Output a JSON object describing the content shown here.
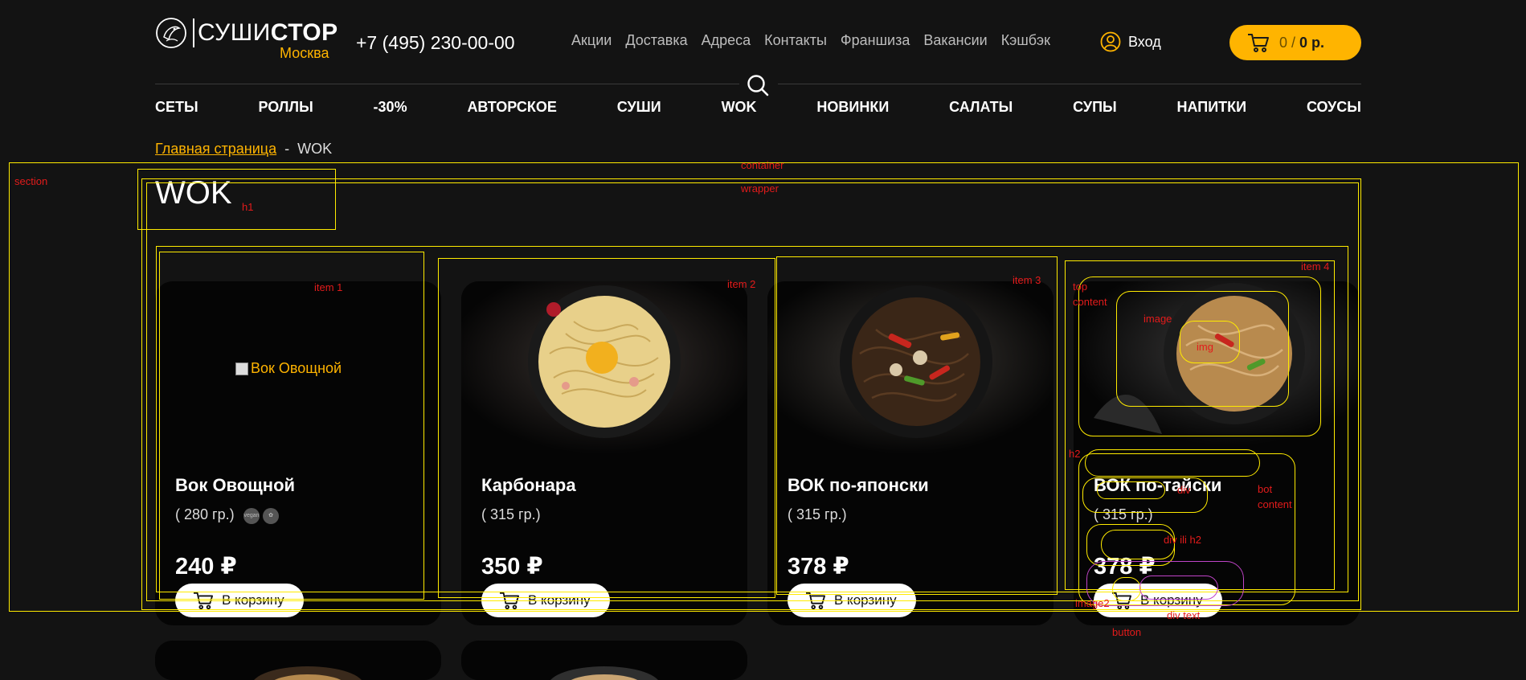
{
  "header": {
    "logo": {
      "text_light": "СУШИ",
      "text_bold": "СТОР",
      "city": "Москва"
    },
    "phone": "+7 (495) 230-00-00",
    "top_nav": [
      "Акции",
      "Доставка",
      "Адреса",
      "Контакты",
      "Франшиза",
      "Вакансии",
      "Кэшбэк"
    ],
    "login_label": "Вход",
    "cart": {
      "count": "0",
      "separator": " / ",
      "total": "0 р."
    }
  },
  "category_nav": [
    "СЕТЫ",
    "РОЛЛЫ",
    "-30%",
    "АВТОРСКОЕ",
    "СУШИ",
    "WOK",
    "НОВИНКИ",
    "САЛАТЫ",
    "СУПЫ",
    "НАПИТКИ",
    "СОУСЫ"
  ],
  "breadcrumb": {
    "home": "Главная страница",
    "separator": "-",
    "current": "WOK"
  },
  "page_title": "WOK",
  "products": [
    {
      "name": "Вок Овощной",
      "weight": "( 280 гр.)",
      "price": "240 ₽",
      "image_alt": "Вок Овощной",
      "image_broken": true,
      "badges": [
        "vegan",
        "veg"
      ]
    },
    {
      "name": "Карбонара",
      "weight": "( 315 гр.)",
      "price": "350 ₽",
      "image_alt": "Карбонара",
      "image_broken": false
    },
    {
      "name": "ВОК по-японски",
      "weight": "( 315 гр.)",
      "price": "378 ₽",
      "image_alt": "ВОК по-японски",
      "image_broken": false
    },
    {
      "name": "ВОК по-тайски",
      "weight": "( 315 гр.)",
      "price": "378 ₽",
      "image_alt": "ВОК по-тайски",
      "image_broken": false
    }
  ],
  "add_to_cart_label": "В корзину",
  "annotations": {
    "section": "section",
    "container": "container",
    "wrapper": "wrapper",
    "h1": "h1",
    "item1": "item 1",
    "item2": "item 2",
    "item3": "item 3",
    "item4": "item 4",
    "top_content": "top\ncontent",
    "image": "image",
    "img": "img",
    "h2": "h2",
    "div": "div",
    "bot_content": "bot\ncontent",
    "div_ili_h2": "div ili h2",
    "image2": "image2",
    "div_text": "div text",
    "button": "button"
  },
  "colors": {
    "background": "#131313",
    "card": "#050505",
    "accent": "#ffb400",
    "annotation_box": "#ffeb00",
    "annotation_text": "#e31b1b",
    "annotation_button": "#c044c8"
  }
}
